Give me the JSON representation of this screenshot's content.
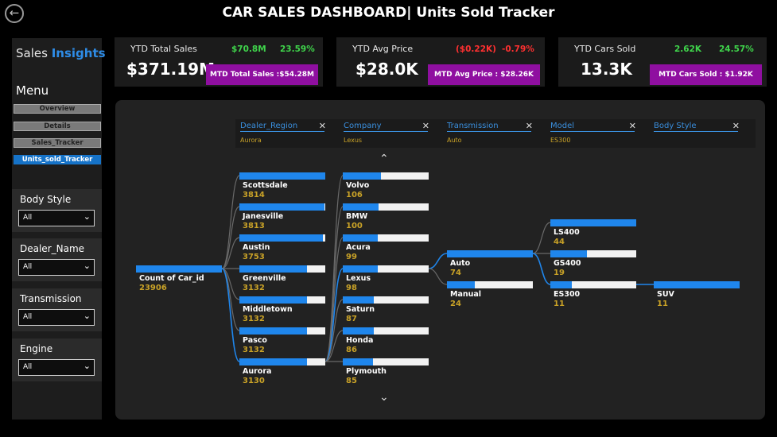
{
  "header": {
    "title": "CAR SALES DASHBOARD| Units Sold Tracker",
    "back_icon": "back-arrow-icon"
  },
  "sidebar": {
    "brand_part1": "Sales",
    "brand_part2": "Insights",
    "menu_title": "Menu",
    "nav": [
      {
        "label": "Overview",
        "active": false
      },
      {
        "label": "Details",
        "active": false
      },
      {
        "label": "Sales_Tracker",
        "active": false
      },
      {
        "label": "Units_sold_Tracker",
        "active": true
      }
    ],
    "filters": [
      {
        "label": "Body Style",
        "value": "All"
      },
      {
        "label": "Dealer_Name",
        "value": "All"
      },
      {
        "label": "Transmission",
        "value": "All"
      },
      {
        "label": "Engine",
        "value": "All"
      }
    ]
  },
  "kpis": [
    {
      "label": "YTD Total Sales",
      "value": "$371.19M",
      "delta1": "$70.8M",
      "delta1_color": "green",
      "delta2": "23.59%",
      "delta2_color": "green",
      "mtd": "MTD Total Sales :$54.28M"
    },
    {
      "label": "YTD Avg Price",
      "value": "$28.0K",
      "delta1": "($0.22K)",
      "delta1_color": "red",
      "delta2": "-0.79%",
      "delta2_color": "red",
      "mtd": "MTD Avg Price : $28.26K"
    },
    {
      "label": "YTD Cars Sold",
      "value": "13.3K",
      "delta1": "2.62K",
      "delta1_color": "green",
      "delta2": "24.57%",
      "delta2_color": "green",
      "mtd": "MTD Cars Sold : $1.92K"
    }
  ],
  "tree": {
    "levels": [
      {
        "header": "Dealer_Region",
        "selected": "Aurora"
      },
      {
        "header": "Company",
        "selected": "Lexus"
      },
      {
        "header": "Transmission",
        "selected": "Auto"
      },
      {
        "header": "Model",
        "selected": "ES300"
      },
      {
        "header": "Body Style",
        "selected": ""
      }
    ],
    "root": {
      "name": "Count of Car_id",
      "value": "23906",
      "fill": 1.0
    },
    "regions": [
      {
        "name": "Scottsdale",
        "value": "3814",
        "fill": 1.0
      },
      {
        "name": "Janesville",
        "value": "3813",
        "fill": 0.99
      },
      {
        "name": "Austin",
        "value": "3753",
        "fill": 0.97
      },
      {
        "name": "Greenville",
        "value": "3132",
        "fill": 0.79
      },
      {
        "name": "Middletown",
        "value": "3132",
        "fill": 0.79
      },
      {
        "name": "Pasco",
        "value": "3132",
        "fill": 0.79
      },
      {
        "name": "Aurora",
        "value": "3130",
        "fill": 0.79
      }
    ],
    "companies": [
      {
        "name": "Volvo",
        "value": "106",
        "fill": 0.44
      },
      {
        "name": "BMW",
        "value": "100",
        "fill": 0.42
      },
      {
        "name": "Acura",
        "value": "99",
        "fill": 0.41
      },
      {
        "name": "Lexus",
        "value": "98",
        "fill": 0.41
      },
      {
        "name": "Saturn",
        "value": "87",
        "fill": 0.36
      },
      {
        "name": "Honda",
        "value": "86",
        "fill": 0.36
      },
      {
        "name": "Plymouth",
        "value": "85",
        "fill": 0.35
      }
    ],
    "transmissions": [
      {
        "name": "Auto",
        "value": "74",
        "fill": 1.0
      },
      {
        "name": "Manual",
        "value": "24",
        "fill": 0.32
      }
    ],
    "models": [
      {
        "name": "LS400",
        "value": "44",
        "fill": 1.0
      },
      {
        "name": "GS400",
        "value": "19",
        "fill": 0.43
      },
      {
        "name": "ES300",
        "value": "11",
        "fill": 0.25
      }
    ],
    "body_styles": [
      {
        "name": "SUV",
        "value": "11",
        "fill": 1.0
      }
    ],
    "colors": {
      "link": "#6a6a6a",
      "link_active": "#1f86ec",
      "bar_fill": "#1f86ec",
      "bar_track": "#f2f2f2",
      "value_text": "#c9a227"
    }
  }
}
